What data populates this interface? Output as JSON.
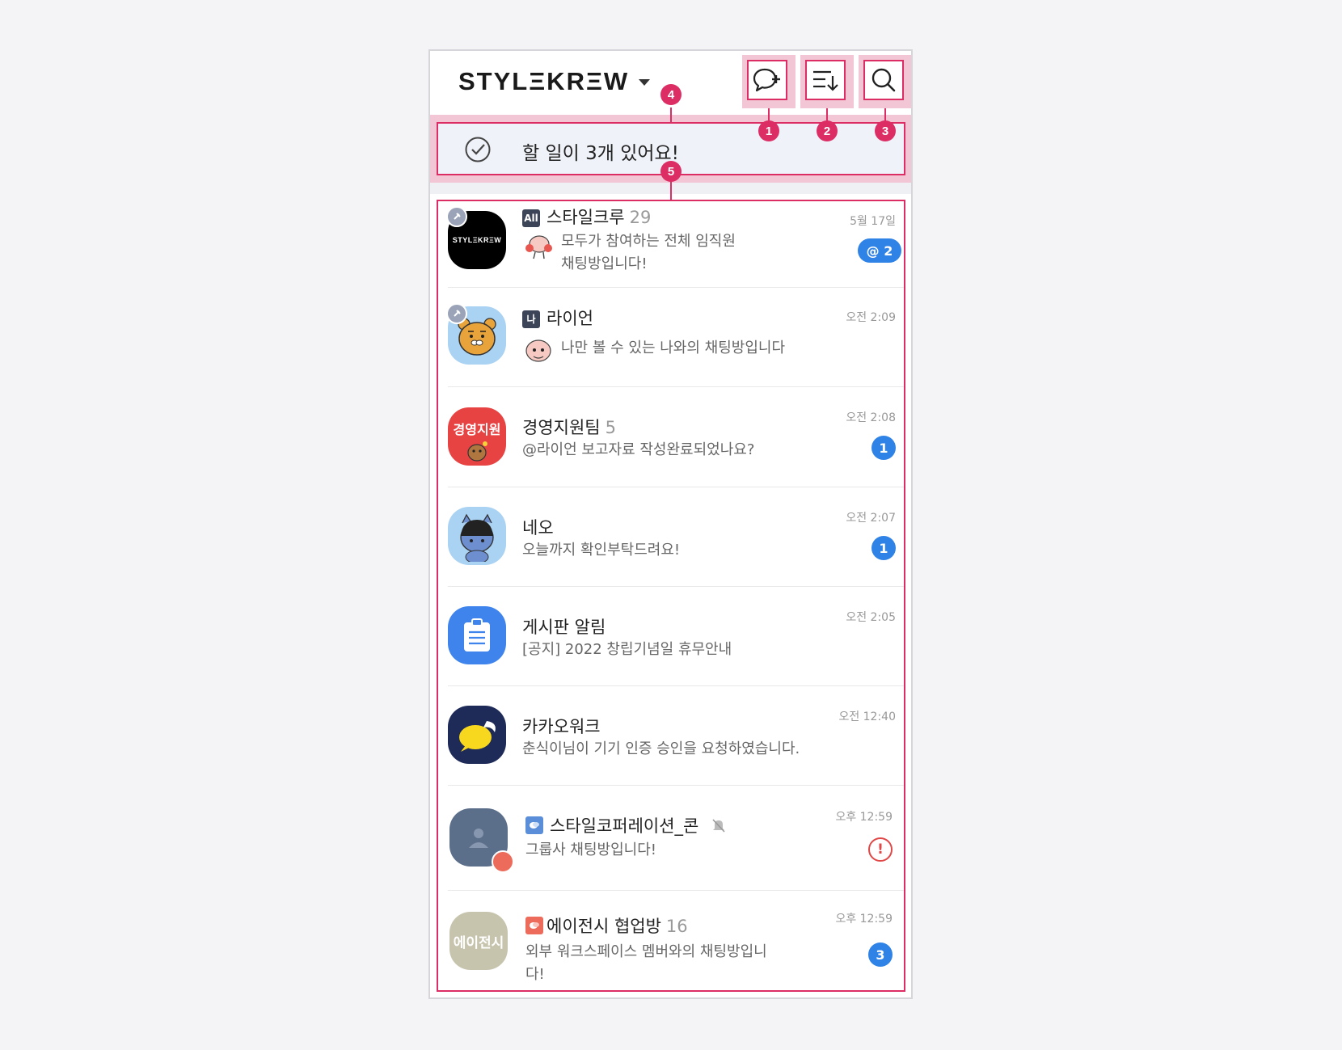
{
  "header": {
    "logo": "STYLΞKRΞW",
    "buttons": [
      {
        "name": "new-chat-button",
        "icon": "chat-plus-icon"
      },
      {
        "name": "sort-button",
        "icon": "sort-down-icon"
      },
      {
        "name": "search-button",
        "icon": "search-icon"
      }
    ]
  },
  "todo": {
    "text": "할 일이 3개 있어요!",
    "icon": "check-circle-icon"
  },
  "callouts": [
    "1",
    "2",
    "3",
    "4",
    "5"
  ],
  "chats": [
    {
      "avatar_text": "STYLΞKRΞW",
      "tag": "All",
      "name": "스타일크루",
      "count": "29",
      "preview_lines": [
        "모두가 참여하는 전체 임직원",
        "채팅방입니다!"
      ],
      "time": "5월 17일",
      "badge": "@ 2",
      "pinned": true
    },
    {
      "tag": "나",
      "name": "라이언",
      "count": "",
      "preview_lines": [
        "나만 볼 수 있는 나와의 채팅방입니다"
      ],
      "time": "오전 2:09",
      "pinned": true
    },
    {
      "avatar_text": "경영지원",
      "name": "경영지원팀",
      "count": "5",
      "preview_lines": [
        "@라이언 보고자료 작성완료되었나요?"
      ],
      "time": "오전 2:08",
      "badge": "1"
    },
    {
      "name": "네오",
      "count": "",
      "preview_lines": [
        "오늘까지 확인부탁드려요!"
      ],
      "time": "오전 2:07",
      "badge": "1"
    },
    {
      "name": "게시판 알림",
      "count": "",
      "preview_lines": [
        "[공지] 2022 창립기념일 휴무안내"
      ],
      "time": "오전 2:05"
    },
    {
      "name": "카카오워크",
      "count": "",
      "preview_lines": [
        "춘식이님이 기기 인증 승인을 요청하였습니다."
      ],
      "time": "오전 12:40"
    },
    {
      "name": "스타일코퍼레이션_콘",
      "count": "",
      "preview_lines": [
        "그룹사 채팅방입니다!"
      ],
      "time": "오후 12:59",
      "badge": "!"
    },
    {
      "avatar_text": "에이전시",
      "name": "에이전시 협업방",
      "count": "16",
      "preview_lines": [
        "외부 워크스페이스 멤버와의 채팅방입니",
        "다!"
      ],
      "time": "오후 12:59",
      "badge": "3"
    }
  ],
  "colors": {
    "accent": "#dc2d64",
    "badge": "#2f82e6",
    "todo_bg": "#eff2f8",
    "warning": "#e04848"
  }
}
